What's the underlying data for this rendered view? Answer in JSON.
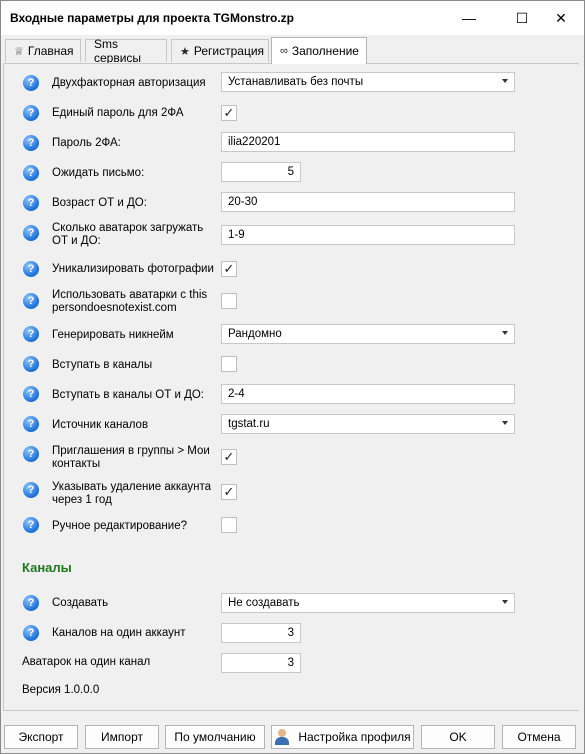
{
  "window": {
    "title": "Входные параметры для проекта TGMonstro.zp",
    "minimize_glyph": "—",
    "maximize_glyph": "☐",
    "close_glyph": "✕"
  },
  "tabs": [
    {
      "label": "Главная",
      "icon": "crown-icon",
      "glyph": "♕"
    },
    {
      "label": "Sms сервисы",
      "icon": "",
      "glyph": ""
    },
    {
      "label": "Регистрация",
      "icon": "star-icon",
      "glyph": "★"
    },
    {
      "label": "Заполнение",
      "icon": "infinity-icon",
      "glyph": "∞"
    }
  ],
  "active_tab": "Заполнение",
  "fields": [
    {
      "label": "Двухфакторная авторизация",
      "type": "select",
      "value": "Устанавливать без почты"
    },
    {
      "label": "Единый пароль для 2ФА",
      "type": "checkbox",
      "checked": true
    },
    {
      "label": "Пароль 2ФА:",
      "type": "text",
      "value": "ilia220201"
    },
    {
      "label": "Ожидать письмо:",
      "type": "number",
      "value": "5"
    },
    {
      "label": "Возраст ОТ и ДО:",
      "type": "text",
      "value": "20-30"
    },
    {
      "label": "Сколько аватарок загружать ОТ и ДО:",
      "type": "text",
      "value": "1-9"
    },
    {
      "label": "Уникализировать фотографии",
      "type": "checkbox",
      "checked": true
    },
    {
      "label": "Использовать аватарки с thispersondoesnotexist.com",
      "type": "checkbox",
      "checked": false
    },
    {
      "label": "Генерировать никнейм",
      "type": "select",
      "value": "Рандомно"
    },
    {
      "label": "Вступать в каналы",
      "type": "checkbox",
      "checked": false
    },
    {
      "label": "Вступать в каналы ОТ и ДО:",
      "type": "text",
      "value": "2-4"
    },
    {
      "label": "Источник каналов",
      "type": "select",
      "value": "tgstat.ru"
    },
    {
      "label": "Приглашения в группы > Мои контакты",
      "type": "checkbox",
      "checked": true
    },
    {
      "label": "Указывать удаление аккаунта через 1 год",
      "type": "checkbox",
      "checked": true
    },
    {
      "label": "Ручное редактирование?",
      "type": "checkbox",
      "checked": false
    }
  ],
  "channels_section": {
    "title": "Каналы",
    "fields": [
      {
        "label": "Создавать",
        "type": "select",
        "value": "Не создавать"
      },
      {
        "label": "Каналов на один аккаунт",
        "type": "number",
        "value": "3"
      },
      {
        "label": "Аватарок на один канал",
        "type": "number",
        "value": "3"
      }
    ]
  },
  "version": "Версия 1.0.0.0",
  "help_glyph": "?",
  "check_glyph": "✓",
  "buttons": {
    "export": "Экспорт",
    "import": "Импорт",
    "defaults": "По умолчанию",
    "profile": "Настройка профиля",
    "ok": "OK",
    "cancel": "Отмена"
  },
  "colors": {
    "section_title": "#1c7a1c",
    "help_icon": "#1a6fd6"
  }
}
